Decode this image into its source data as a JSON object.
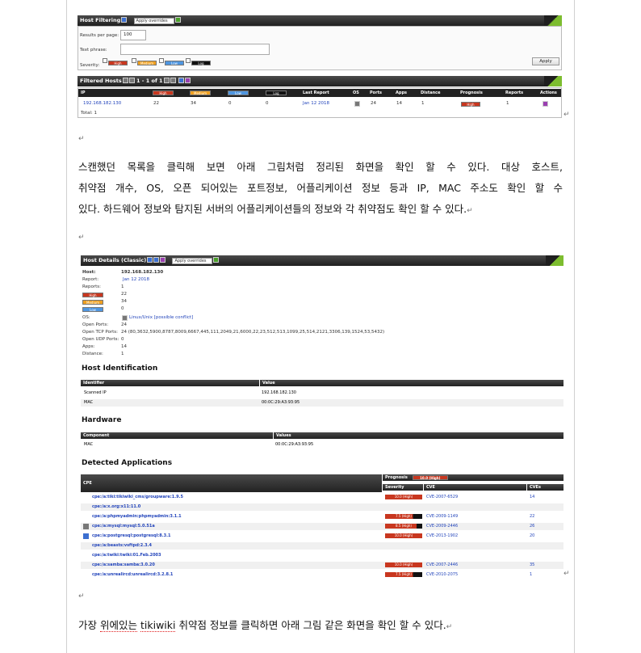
{
  "marks": {
    "paragraph": "↵"
  },
  "shot1": {
    "filter_title": "Host Filtering",
    "apply_overrides": "Apply overrides",
    "results_label": "Results per page:",
    "results_value": "100",
    "text_phrase_label": "Text phrase:",
    "severity_label": "Severity:",
    "sev_high": "High",
    "sev_medium": "Medium",
    "sev_low": "Low",
    "sev_log": "Log",
    "apply_button": "Apply",
    "filtered_title": "Filtered Hosts",
    "pagination": "1 - 1 of 1",
    "columns": [
      "IP",
      "High",
      "Medium",
      "Low",
      "Log",
      "Last Report",
      "OS",
      "Ports",
      "Apps",
      "Distance",
      "Prognosis",
      "Reports",
      "Actions"
    ],
    "row": {
      "ip": "192.168.182.130",
      "high": "22",
      "medium": "34",
      "low": "0",
      "log": "0",
      "last_report": "Jan 12 2018",
      "ports": "24",
      "apps": "14",
      "distance": "1",
      "prognosis": "High",
      "reports": "1"
    },
    "total": "Total: 1"
  },
  "para1": {
    "line1": "스캔했던 목록을 클릭해 보면 아래 그림처럼 정리된 화면을 확인 할 수 있다. 대상 호스트,",
    "line2": "취약점 개수, OS, 오픈 되어있는 포트정보, 어플리케이션 정보 등과 IP, MAC 주소도 확인 할 수",
    "line3": "있다. 하드웨어 정보와 탐지된 서버의 어플리케이션들의 정보와 각 취약점도 확인 할 수 있다."
  },
  "shot2": {
    "title": "Host Details (Classic)",
    "apply_overrides": "Apply overrides",
    "host_label": "Host:",
    "host_value": "192.168.182.130",
    "report_label": "Report:",
    "report_value": "Jan 12 2018",
    "reports_label": "Reports:",
    "reports_value": "1",
    "high_value": "22",
    "medium_value": "34",
    "low_value": "0",
    "sev_high": "High",
    "sev_medium": "Medium",
    "sev_low": "Low",
    "os_label": "OS:",
    "os_value": "Linux/Unix [possible conflict]",
    "open_ports_label": "Open Ports:",
    "open_ports_value": "24",
    "tcp_label": "Open TCP Ports:",
    "tcp_value": "24 (80,3632,5900,8787,8009,6667,445,111,2049,21,6000,22,23,512,513,1099,25,514,2121,3306,139,1524,53,5432)",
    "udp_label": "Open UDP Ports:",
    "udp_value": "0",
    "apps_label": "Apps:",
    "apps_value": "14",
    "distance_label": "Distance:",
    "distance_value": "1",
    "hostid_heading": "Host Identification",
    "hostid_cols": [
      "Identifier",
      "Value"
    ],
    "hostid_rows": [
      [
        "Scanned IP",
        "192.168.182.130"
      ],
      [
        "MAC",
        "00:0C:29:A3:93:95"
      ]
    ],
    "hw_heading": "Hardware",
    "hw_cols": [
      "Component",
      "Values"
    ],
    "hw_rows": [
      [
        "MAC",
        "00:0C:29:A3:93:95"
      ]
    ],
    "apps_heading": "Detected Applications",
    "cpe_col": "CPE",
    "prognosis_col": "Prognosis",
    "prognosis_badge": "10.0 (High)",
    "sub_cols": [
      "Severity",
      "CVE",
      "CVEs"
    ],
    "app_rows": [
      {
        "cpe": "cpe:/a:tiki:tikiwiki_cms/groupware:1.9.5",
        "sev": "10.0 (High)",
        "cve": "CVE-2007-6529",
        "cves": "14"
      },
      {
        "cpe": "cpe:/a:x.org:x11:11.0",
        "sev": "",
        "cve": "",
        "cves": ""
      },
      {
        "cpe": "cpe:/a:phpmyadmin:phpmyadmin:3.1.1",
        "sev": "7.5 (High)",
        "cve": "CVE-2009-1149",
        "cves": "22"
      },
      {
        "cpe": "cpe:/a:mysql:mysql:5.0.51a",
        "sev": "8.5 (High)",
        "cve": "CVE-2009-2446",
        "cves": "26"
      },
      {
        "cpe": "cpe:/a:postgresql:postgresql:8.3.1",
        "sev": "10.0 (High)",
        "cve": "CVE-2013-1902",
        "cves": "20"
      },
      {
        "cpe": "cpe:/a:beasts:vsftpd:2.3.4",
        "sev": "",
        "cve": "",
        "cves": ""
      },
      {
        "cpe": "cpe:/a:twiki:twiki:01.Feb.2003",
        "sev": "",
        "cve": "",
        "cves": ""
      },
      {
        "cpe": "cpe:/a:samba:samba:3.0.20",
        "sev": "10.0 (High)",
        "cve": "CVE-2007-2446",
        "cves": "35"
      },
      {
        "cpe": "cpe:/a:unrealircd:unrealircd:3.2.8.1",
        "sev": "7.5 (High)",
        "cve": "CVE-2010-2075",
        "cves": "1"
      }
    ]
  },
  "para2": {
    "before": "가장 ",
    "w1": "위에있는",
    "mid": " ",
    "w2": "tikiwiki",
    "after": " 취약점 정보를 클릭하면 아래 그림 같은 화면을 확인 할 수 있다."
  }
}
